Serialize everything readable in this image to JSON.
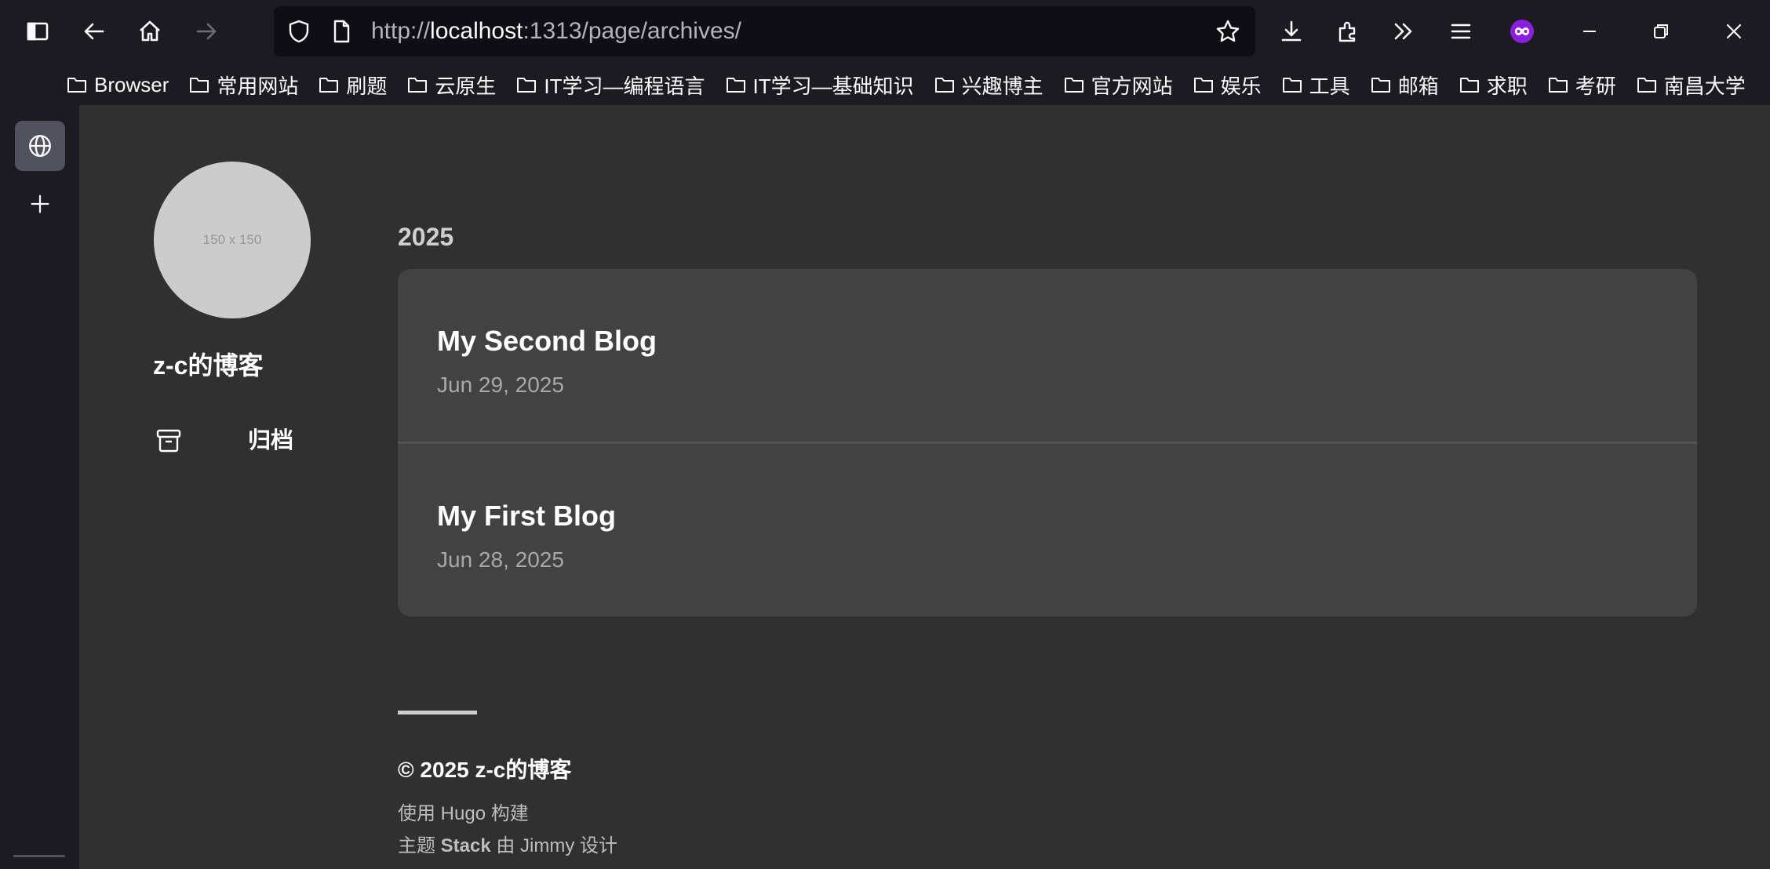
{
  "browser": {
    "url_prefix": "http://",
    "url_host": "localhost",
    "url_path": ":1313/page/archives/",
    "url_full": "http://localhost:1313/page/archives/"
  },
  "bookmarks": [
    {
      "label": "Browser"
    },
    {
      "label": "常用网站"
    },
    {
      "label": "刷题"
    },
    {
      "label": "云原生"
    },
    {
      "label": "IT学习—编程语言"
    },
    {
      "label": "IT学习—基础知识"
    },
    {
      "label": "兴趣博主"
    },
    {
      "label": "官方网站"
    },
    {
      "label": "娱乐"
    },
    {
      "label": "工具"
    },
    {
      "label": "邮箱"
    },
    {
      "label": "求职"
    },
    {
      "label": "考研"
    },
    {
      "label": "南昌大学"
    }
  ],
  "site": {
    "avatar_placeholder": "150 x 150",
    "name": "z-c的博客",
    "menu": [
      {
        "label": "归档",
        "icon": "archive-icon"
      }
    ]
  },
  "archives": {
    "year": "2025",
    "posts": [
      {
        "title": "My Second Blog",
        "date": "Jun 29, 2025"
      },
      {
        "title": "My First Blog",
        "date": "Jun 28, 2025"
      }
    ]
  },
  "footer": {
    "copyright": "© 2025 z-c的博客",
    "powered_by": "使用 Hugo 构建",
    "theme_prefix": "主题",
    "theme_name": "Stack",
    "theme_suffix": "由 Jimmy 设计"
  },
  "colors": {
    "page_bg": "#303030",
    "card_bg": "#424242",
    "browser_chrome": "#1c1b22",
    "accent_extension": "#8b1fe0"
  }
}
